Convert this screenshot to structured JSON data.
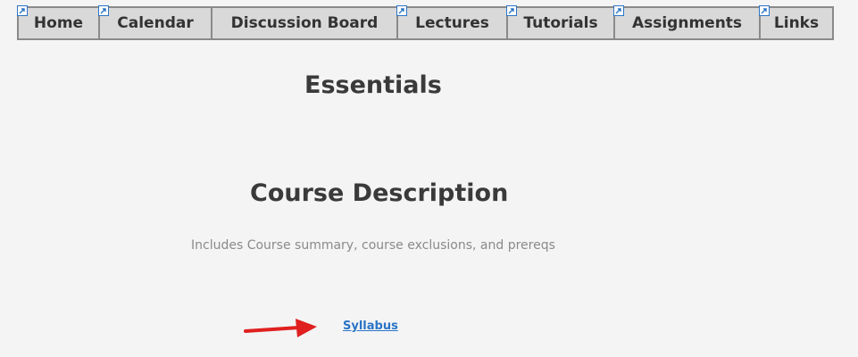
{
  "nav": {
    "items": [
      {
        "label": "Home"
      },
      {
        "label": "Calendar"
      },
      {
        "label": "Discussion Board"
      },
      {
        "label": "Lectures"
      },
      {
        "label": "Tutorials"
      },
      {
        "label": "Assignments"
      },
      {
        "label": "Links"
      }
    ]
  },
  "main": {
    "essentials_heading": "Essentials",
    "course_description_heading": "Course Description",
    "course_description_text": "Includes Course summary, course exclusions, and prereqs",
    "syllabus_link": "Syllabus"
  },
  "annotation": {
    "arrow_color": "#e02020"
  }
}
